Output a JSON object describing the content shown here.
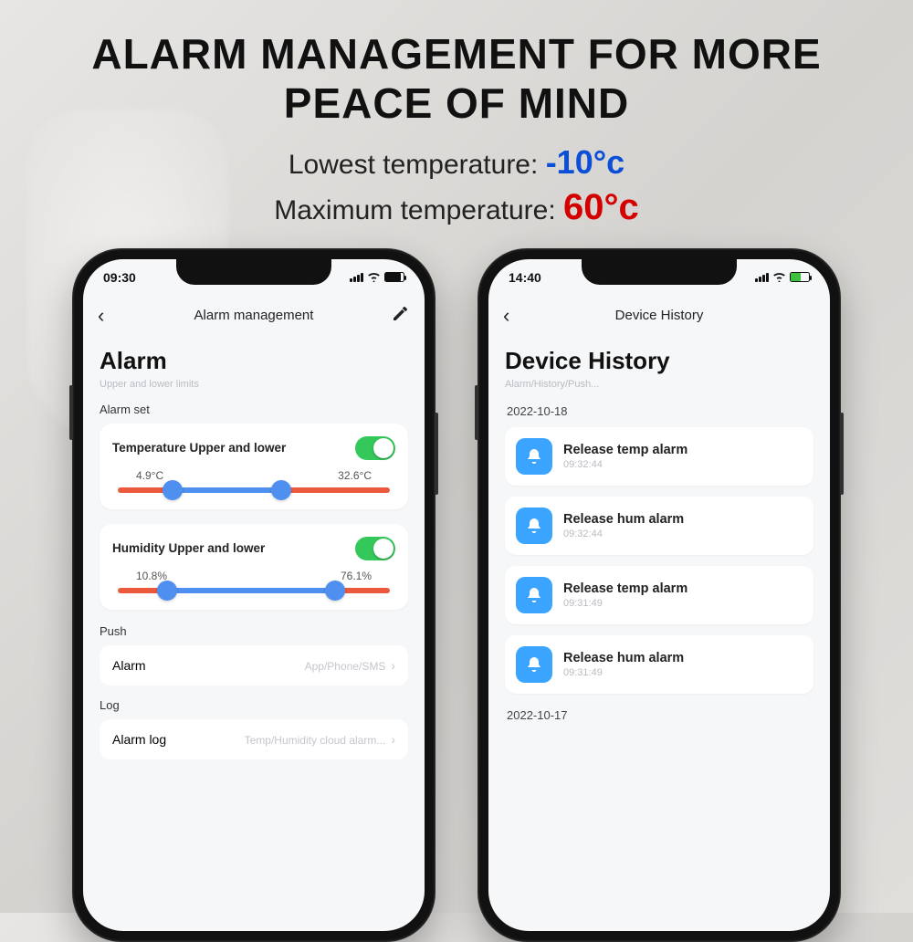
{
  "headline": "ALARM MANAGEMENT FOR MORE PEACE OF MIND",
  "lowest_label": "Lowest temperature:",
  "lowest_value": "-10°c",
  "max_label": "Maximum temperature:",
  "max_value": "60°c",
  "left": {
    "status_time": "09:30",
    "nav_title": "Alarm management",
    "title": "Alarm",
    "subtitle": "Upper and lower limits",
    "alarm_set_label": "Alarm set",
    "temp_card": {
      "title": "Temperature Upper and lower",
      "low": "4.9°C",
      "high": "32.6°C",
      "a": "20%",
      "b": "60%"
    },
    "hum_card": {
      "title": "Humidity Upper and lower",
      "low": "10.8%",
      "high": "76.1%",
      "a": "18%",
      "b": "80%"
    },
    "push_label": "Push",
    "push_row": {
      "title": "Alarm",
      "hint": "App/Phone/SMS"
    },
    "log_label": "Log",
    "log_row": {
      "title": "Alarm log",
      "hint": "Temp/Humidity cloud alarm..."
    }
  },
  "right": {
    "status_time": "14:40",
    "nav_title": "Device History",
    "title": "Device History",
    "subtitle": "Alarm/History/Push...",
    "date1": "2022-10-18",
    "items1": [
      {
        "title": "Release temp alarm",
        "time": "09:32:44"
      },
      {
        "title": "Release hum alarm",
        "time": "09:32:44"
      },
      {
        "title": "Release temp alarm",
        "time": "09:31:49"
      },
      {
        "title": "Release hum alarm",
        "time": "09:31:49"
      }
    ],
    "date2": "2022-10-17"
  }
}
